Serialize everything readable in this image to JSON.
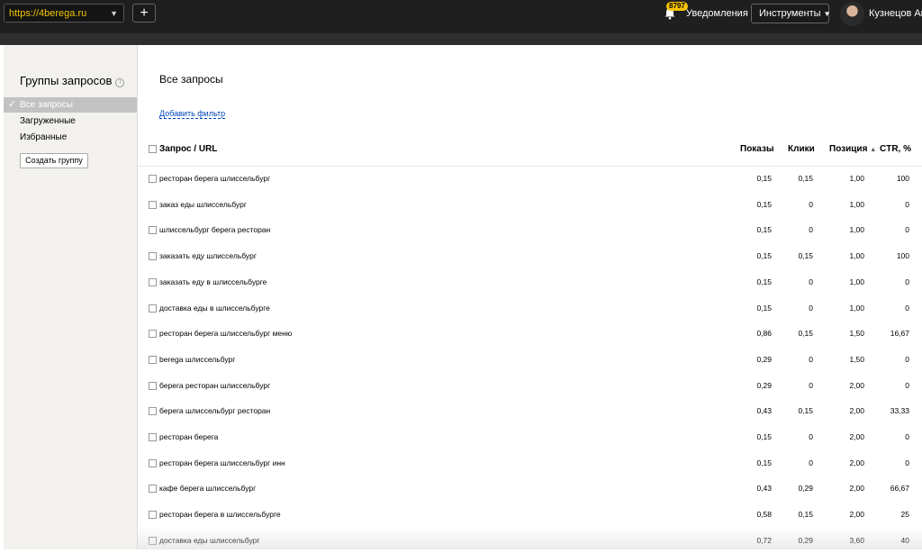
{
  "header": {
    "site": "https://4berega.ru",
    "add_label": "+",
    "notifications_badge": "8797",
    "notifications_label": "Уведомления",
    "tools_label": "Инструменты",
    "user_name": "Кузнецов Ана"
  },
  "sidebar": {
    "title": "Группы запросов",
    "items": [
      {
        "label": "Все запросы"
      },
      {
        "label": "Загруженные"
      },
      {
        "label": "Избранные"
      }
    ],
    "create_group": "Создать группу"
  },
  "main": {
    "title": "Все запросы",
    "add_filter": "Добавить фильтр",
    "columns": {
      "query": "Запрос / URL",
      "shows": "Показы",
      "clicks": "Клики",
      "position": "Позиция",
      "ctr": "CTR, %"
    },
    "rows": [
      {
        "query": "ресторан берега шлиссельбург",
        "shows": "0,15",
        "clicks": "0,15",
        "position": "1,00",
        "ctr": "100"
      },
      {
        "query": "заказ еды шлиссельбург",
        "shows": "0,15",
        "clicks": "0",
        "position": "1,00",
        "ctr": "0"
      },
      {
        "query": "шлиссельбург берега ресторан",
        "shows": "0,15",
        "clicks": "0",
        "position": "1,00",
        "ctr": "0"
      },
      {
        "query": "заказать еду шлиссельбург",
        "shows": "0,15",
        "clicks": "0,15",
        "position": "1,00",
        "ctr": "100"
      },
      {
        "query": "заказать еду в шлиссельбурге",
        "shows": "0,15",
        "clicks": "0",
        "position": "1,00",
        "ctr": "0"
      },
      {
        "query": "доставка еды в шлиссельбурге",
        "shows": "0,15",
        "clicks": "0",
        "position": "1,00",
        "ctr": "0"
      },
      {
        "query": "ресторан берега шлиссельбург меню",
        "shows": "0,86",
        "clicks": "0,15",
        "position": "1,50",
        "ctr": "16,67"
      },
      {
        "query": "berega шлиссельбург",
        "shows": "0,29",
        "clicks": "0",
        "position": "1,50",
        "ctr": "0"
      },
      {
        "query": "берега ресторан шлиссельбург",
        "shows": "0,29",
        "clicks": "0",
        "position": "2,00",
        "ctr": "0"
      },
      {
        "query": "берега шлиссельбург ресторан",
        "shows": "0,43",
        "clicks": "0,15",
        "position": "2,00",
        "ctr": "33,33"
      },
      {
        "query": "ресторан берега",
        "shows": "0,15",
        "clicks": "0",
        "position": "2,00",
        "ctr": "0"
      },
      {
        "query": "ресторан берега шлиссельбург инн",
        "shows": "0,15",
        "clicks": "0",
        "position": "2,00",
        "ctr": "0"
      },
      {
        "query": "кафе берега шлиссельбург",
        "shows": "0,43",
        "clicks": "0,29",
        "position": "2,00",
        "ctr": "66,67"
      },
      {
        "query": "ресторан берега в шлиссельбурге",
        "shows": "0,58",
        "clicks": "0,15",
        "position": "2,00",
        "ctr": "25"
      },
      {
        "query": "доставка еды шлиссельбург",
        "shows": "0,72",
        "clicks": "0,29",
        "position": "3,60",
        "ctr": "40"
      }
    ]
  }
}
